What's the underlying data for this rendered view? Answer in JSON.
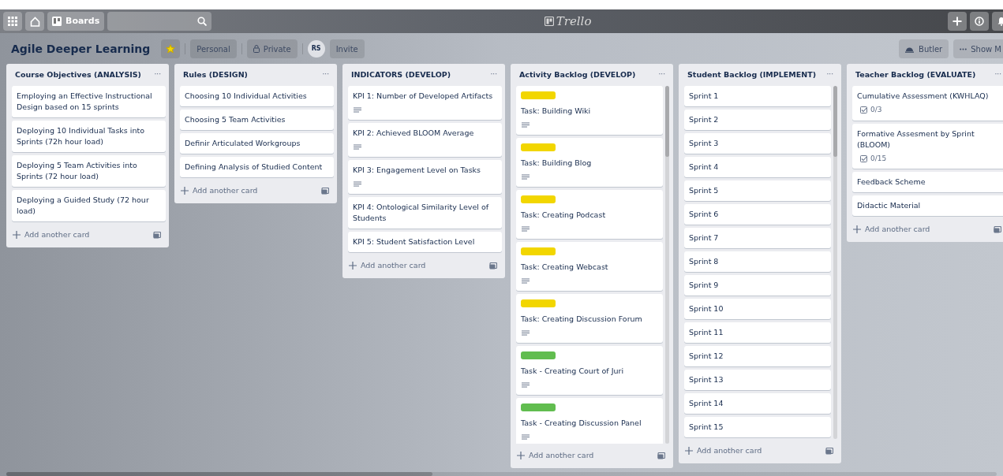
{
  "topbar": {
    "boards_label": "Boards",
    "logo_text": "Trello"
  },
  "board_header": {
    "title": "Agile Deeper Learning",
    "starred": true,
    "team": "Personal",
    "visibility": "Private",
    "member_initials": "RS",
    "invite": "Invite",
    "butler": "Butler",
    "show_menu": "Show M"
  },
  "lists": [
    {
      "title": "Course Objectives (ANALYSIS)",
      "menu": "···",
      "add_card": "Add another card",
      "cards": [
        {
          "text": "Employing an Effective Instructional Design based on 15 sprints",
          "description": false
        },
        {
          "text": "Deploying 10 Individual Tasks into Sprints (72h hour load)",
          "description": false
        },
        {
          "text": "Deploying 5 Team Activities into Sprints (72 hour load)",
          "description": false
        },
        {
          "text": "Deploying a Guided Study (72 hour load)",
          "description": false
        }
      ]
    },
    {
      "title": "Rules (DESIGN)",
      "menu": "···",
      "add_card": "Add another card",
      "cards": [
        {
          "text": "Choosing 10 Individual Activities",
          "description": false
        },
        {
          "text": "Choosing 5 Team Activities",
          "description": false
        },
        {
          "text": "Definir Articulated Workgroups",
          "description": false
        },
        {
          "text": "Defining Analysis of Studied Content",
          "description": false
        }
      ]
    },
    {
      "title": "INDICATORS (DEVELOP)",
      "menu": "···",
      "add_card": "Add another card",
      "cards": [
        {
          "text": "KPI 1: Number of Developed Artifacts",
          "description": true
        },
        {
          "text": "KPI 2: Achieved BLOOM Average",
          "description": true
        },
        {
          "text": "KPI 3: Engagement Level on Tasks",
          "description": true
        },
        {
          "text": "KPI 4: Ontological Similarity Level of Students",
          "description": false
        },
        {
          "text": "KPI 5: Student Satisfaction Level",
          "description": false
        }
      ]
    },
    {
      "title": "Activity Backlog (DEVELOP)",
      "menu": "···",
      "add_card": "Add another card",
      "cards": [
        {
          "text": "Task: Building Wiki",
          "description": true,
          "color": "#f2d600"
        },
        {
          "text": "Task: Building Blog",
          "description": true,
          "color": "#f2d600"
        },
        {
          "text": "Task: Creating Podcast",
          "description": true,
          "color": "#f2d600"
        },
        {
          "text": "Task: Creating Webcast",
          "description": true,
          "color": "#f2d600"
        },
        {
          "text": "Task: Creating Discussion Forum",
          "description": true,
          "color": "#f2d600"
        },
        {
          "text": "Task - Creating Court of Juri",
          "description": true,
          "color": "#61bd4f"
        },
        {
          "text": "Task - Creating Discussion Panel",
          "description": true,
          "color": "#61bd4f"
        }
      ]
    },
    {
      "title": "Student Backlog (IMPLEMENT)",
      "menu": "···",
      "add_card": "Add another card",
      "cards": [
        {
          "text": "Sprint 1",
          "description": false
        },
        {
          "text": "Sprint 2",
          "description": false
        },
        {
          "text": "Sprint 3",
          "description": false
        },
        {
          "text": "Sprint 4",
          "description": false
        },
        {
          "text": "Sprint 5",
          "description": false
        },
        {
          "text": "Sprint 6",
          "description": false
        },
        {
          "text": "Sprint 7",
          "description": false
        },
        {
          "text": "Sprint 8",
          "description": false
        },
        {
          "text": "Sprint 9",
          "description": false
        },
        {
          "text": "Sprint 10",
          "description": false
        },
        {
          "text": "Sprint 11",
          "description": false
        },
        {
          "text": "Sprint 12",
          "description": false
        },
        {
          "text": "Sprint 13",
          "description": false
        },
        {
          "text": "Sprint 14",
          "description": false
        },
        {
          "text": "Sprint 15",
          "description": false
        }
      ]
    },
    {
      "title": "Teacher Backlog (EVALUATE)",
      "menu": "···",
      "add_card": "Add another card",
      "cards": [
        {
          "text": "Cumulative Assessment (KWHLAQ)",
          "description": false,
          "checklist": "0/3"
        },
        {
          "text": "Formative Assesment by Sprint (BLOOM)",
          "description": false,
          "checklist": "0/15"
        },
        {
          "text": "Feedback Scheme",
          "description": false
        },
        {
          "text": "Didactic Material",
          "description": false
        }
      ]
    }
  ]
}
